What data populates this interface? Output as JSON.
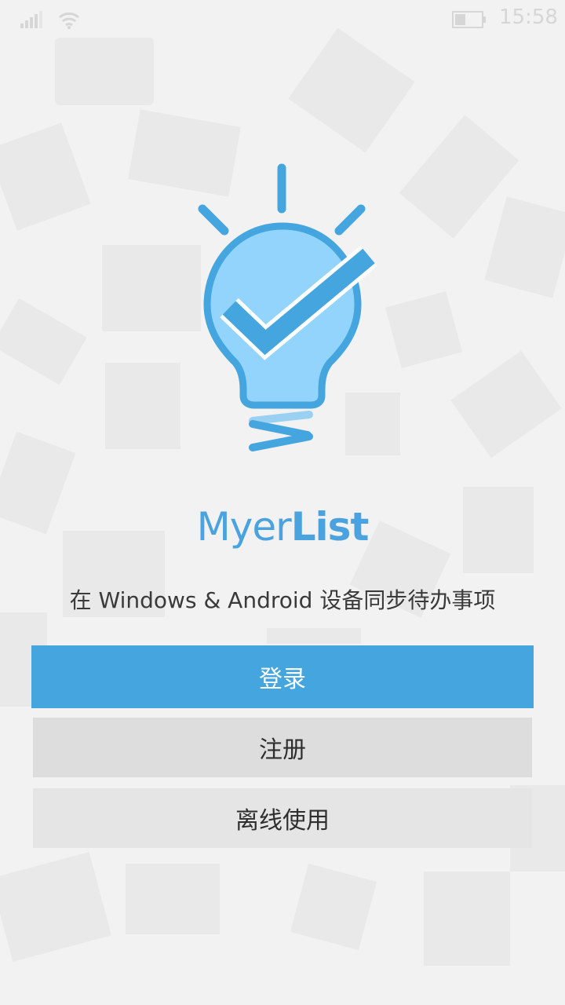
{
  "status_bar": {
    "time": "15:58",
    "signal_icon": "signal-bars-icon",
    "wifi_icon": "wifi-icon",
    "battery_icon": "battery-icon",
    "battery_level": 0.4
  },
  "logo": {
    "icon": "lightbulb-checkmark-icon",
    "colors": {
      "bulb_fill": "#92d4fb",
      "outline": "#45a5de",
      "check": "#45a5de"
    }
  },
  "app": {
    "name_light": "Myer",
    "name_bold": "List"
  },
  "tagline": "在 Windows & Android 设备同步待办事项",
  "buttons": {
    "login": "登录",
    "register": "注册",
    "offline": "离线使用"
  },
  "colors": {
    "accent": "#45a5de",
    "background": "#f2f2f2"
  }
}
